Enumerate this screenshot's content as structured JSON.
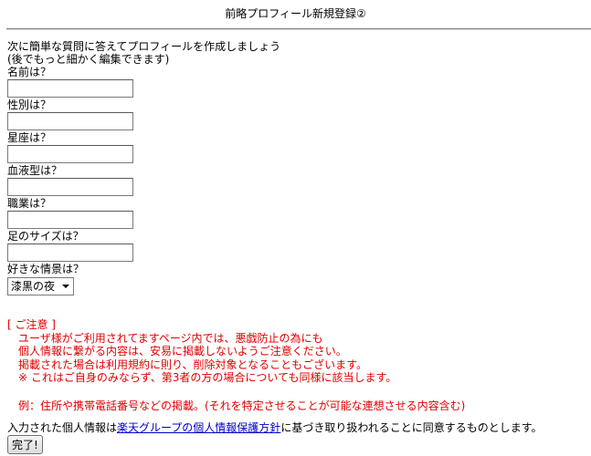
{
  "page": {
    "title": "前略プロフィール新規登録②"
  },
  "intro": {
    "line1": "次に簡単な質問に答えてプロフィールを作成しましょう",
    "line2": "(後でもっと細かく編集できます)"
  },
  "questions": [
    {
      "label": "名前は？",
      "value": ""
    },
    {
      "label": "性別は？",
      "value": ""
    },
    {
      "label": "星座は？",
      "value": ""
    },
    {
      "label": "血液型は？",
      "value": ""
    },
    {
      "label": "職業は？",
      "value": ""
    },
    {
      "label": "足のサイズは？",
      "value": ""
    }
  ],
  "scenery": {
    "label": "好きな情景は？",
    "selected": "漆黒の夜"
  },
  "caution": {
    "heading": "[ ご注意 ]",
    "lines": [
      "　ユーザ様がご利用されてますページ内では、悪戯防止の為にも",
      "　個人情報に繋がる内容は、安易に掲載しないようご注意ください。",
      "　掲載された場合は利用規約に則り、削除対象となることもございます。",
      "　※ これはご自身のみならず、第3者の方の場合についても同様に該当します。"
    ],
    "example": "　例：住所や携帯電話番号などの掲載。(それを特定させることが可能な連想させる内容含む)"
  },
  "consent": {
    "before": "入力された個人情報は",
    "link": "楽天グループの個人情報保護方針",
    "after": "に基づき取り扱われることに同意するものとします。"
  },
  "submit": {
    "label": "完了!"
  }
}
